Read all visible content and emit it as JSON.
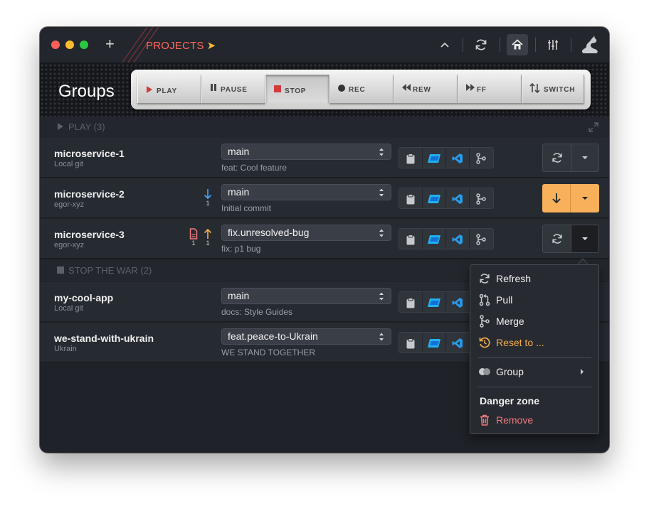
{
  "titlebar": {
    "projects_label": "PROJECTS",
    "projects_arrow": "➤",
    "add_glyph": "+",
    "icons": [
      "chevron-up-icon",
      "refresh-icon",
      "home-icon",
      "sliders-icon",
      "cat-avatar-icon"
    ]
  },
  "header": {
    "title": "Groups",
    "transport": [
      {
        "label": "PLAY",
        "icon": "play-icon"
      },
      {
        "label": "PAUSE",
        "icon": "pause-icon"
      },
      {
        "label": "STOP",
        "icon": "stop-icon"
      },
      {
        "label": "REC",
        "icon": "record-icon"
      },
      {
        "label": "REW",
        "icon": "rewind-icon"
      },
      {
        "label": "FF",
        "icon": "fast-forward-icon"
      },
      {
        "label": "SWITCH",
        "icon": "switch-icon"
      }
    ]
  },
  "groups": [
    {
      "label": "PLAY (3)",
      "rows": [
        {
          "name": "microservice-1",
          "owner": "Local git",
          "branch": "main",
          "commit": "feat: Cool feature"
        },
        {
          "name": "microservice-2",
          "owner": "egor-xyz",
          "branch": "main",
          "commit": "Initial commit",
          "behind": "1"
        },
        {
          "name": "microservice-3",
          "owner": "egor-xyz",
          "branch": "fix.unresolved-bug",
          "commit": "fix: p1 bug",
          "changed_files": "1",
          "ahead": "1"
        }
      ]
    },
    {
      "label": "STOP THE WAR (2)",
      "rows": [
        {
          "name": "my-cool-app",
          "owner": "Local git",
          "branch": "main",
          "commit": "docs: Style Guides"
        },
        {
          "name": "we-stand-with-ukrain",
          "owner": "Ukrain",
          "branch": "feat.peace-to-Ukrain",
          "commit": "WE STAND TOGETHER"
        }
      ]
    }
  ],
  "menu": {
    "items": [
      {
        "label": "Refresh",
        "icon": "refresh-icon"
      },
      {
        "label": "Pull",
        "icon": "pull-request-icon"
      },
      {
        "label": "Merge",
        "icon": "merge-icon"
      },
      {
        "label": "Reset to ...",
        "icon": "reset-icon"
      },
      {
        "label": "Group",
        "icon": "toggle-icon"
      },
      {
        "label": "Remove",
        "icon": "trash-icon"
      }
    ],
    "danger_heading": "Danger zone"
  },
  "colors": {
    "accent_orange": "#f8b15a",
    "danger": "#f27a7e",
    "projects": "#ff6a5c",
    "info_blue": "#4aa3ff"
  }
}
